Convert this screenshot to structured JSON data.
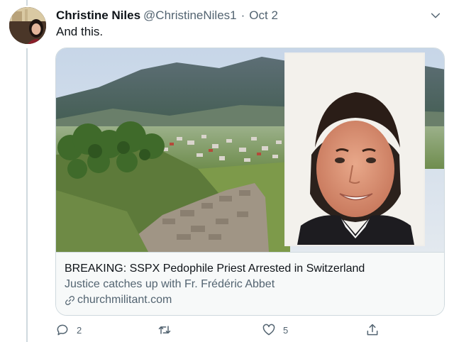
{
  "tweet": {
    "author_name": "Christine Niles",
    "author_handle": "@ChristineNiles1",
    "separator": "·",
    "date": "Oct 2",
    "text": "And this."
  },
  "card": {
    "title": "BREAKING: SSPX Pedophile Priest Arrested in Switzerland",
    "description": "Justice catches up with Fr. Frédéric Abbet",
    "domain": "churchmilitant.com",
    "domain_icon": "link-icon"
  },
  "actions": {
    "reply_count": "2",
    "retweet_count": "",
    "like_count": "5"
  },
  "colors": {
    "primary_text": "#0f1419",
    "secondary_text": "#536471",
    "border": "#cfd9de"
  }
}
